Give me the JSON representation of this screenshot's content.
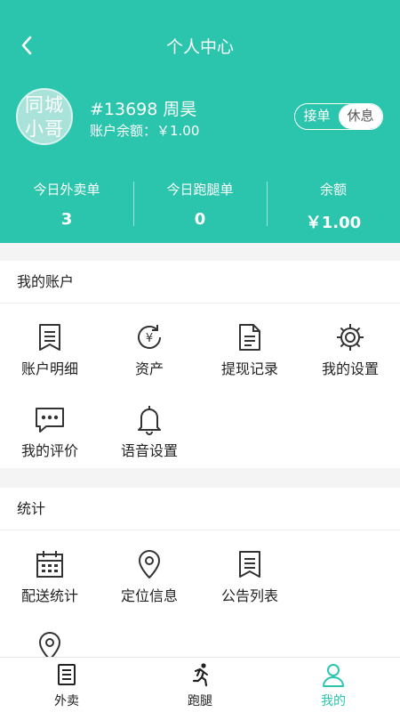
{
  "header": {
    "title": "个人中心",
    "accent_color": "#2ac5ac"
  },
  "user": {
    "avatar_line1": "同城",
    "avatar_line2": "小哥",
    "name": "#13698 周昊",
    "balance_text": "账户余额：￥1.00"
  },
  "status_toggle": {
    "on_label": "接单",
    "off_label": "休息",
    "selected": "休息"
  },
  "stats": [
    {
      "label": "今日外卖单",
      "value": "3"
    },
    {
      "label": "今日跑腿单",
      "value": "0"
    },
    {
      "label": "余额",
      "value": "￥1.00"
    }
  ],
  "account_section": {
    "title": "我的账户",
    "items": [
      {
        "label": "账户明细",
        "icon": "bookmark-list-icon"
      },
      {
        "label": "资产",
        "icon": "yen-cycle-icon"
      },
      {
        "label": "提现记录",
        "icon": "document-icon"
      },
      {
        "label": "我的设置",
        "icon": "gear-icon"
      },
      {
        "label": "我的评价",
        "icon": "chat-bubble-icon"
      },
      {
        "label": "语音设置",
        "icon": "bell-icon"
      }
    ]
  },
  "stats_section": {
    "title": "统计",
    "items": [
      {
        "label": "配送统计",
        "icon": "calendar-icon"
      },
      {
        "label": "定位信息",
        "icon": "location-pin-icon"
      },
      {
        "label": "公告列表",
        "icon": "bookmark-list-icon"
      }
    ],
    "partial_item_icon": "location-pin-icon"
  },
  "tabbar": {
    "tabs": [
      {
        "label": "外卖",
        "icon": "receipt-icon"
      },
      {
        "label": "跑腿",
        "icon": "runner-icon"
      },
      {
        "label": "我的",
        "icon": "user-icon"
      }
    ],
    "active": "我的"
  }
}
